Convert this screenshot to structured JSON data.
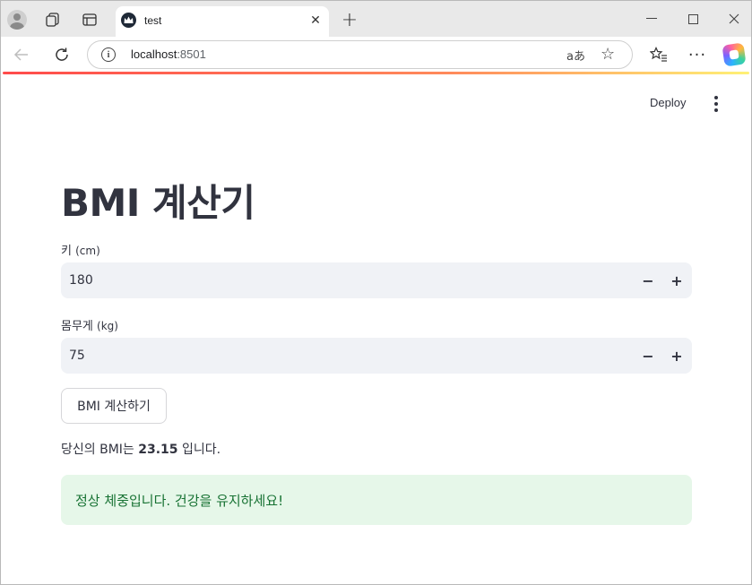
{
  "browser": {
    "tab_title": "test",
    "url_host": "localhost",
    "url_port": ":8501",
    "translate_glyph": "aあ",
    "more_glyph": "···"
  },
  "toolbar": {
    "deploy_label": "Deploy"
  },
  "main": {
    "title": "BMI 계산기",
    "height_label": "키",
    "height_unit": "(cm)",
    "height_value": "180",
    "weight_label": "몸무게",
    "weight_unit": "(kg)",
    "weight_value": "75",
    "stepper_minus": "−",
    "stepper_plus": "+",
    "calc_button_label": "BMI 계산하기",
    "result_prefix": "당신의 BMI는",
    "result_value": "23.15",
    "result_suffix": "입니다.",
    "success_message": "정상 체중입니다. 건강을 유지하세요!"
  },
  "colors": {
    "accent": "#ff4b4b",
    "success_bg": "#e6f7e9",
    "success_text": "#177233",
    "input_bg": "#f0f2f6",
    "text": "#31333f"
  },
  "icons": {
    "profile": "profile-avatar-icon",
    "workspaces": "workspaces-icon",
    "tab_actions": "tab-actions-icon",
    "favicon": "streamlit-crown-icon",
    "close": "close-icon",
    "new_tab": "plus-icon",
    "back": "back-arrow-icon",
    "reload": "reload-icon",
    "site_info": "info-icon",
    "translate": "translate-icon",
    "favorite": "star-icon",
    "favorites_list": "favorites-list-icon",
    "more": "more-icon",
    "copilot": "copilot-icon",
    "menu": "kebab-menu-icon"
  }
}
